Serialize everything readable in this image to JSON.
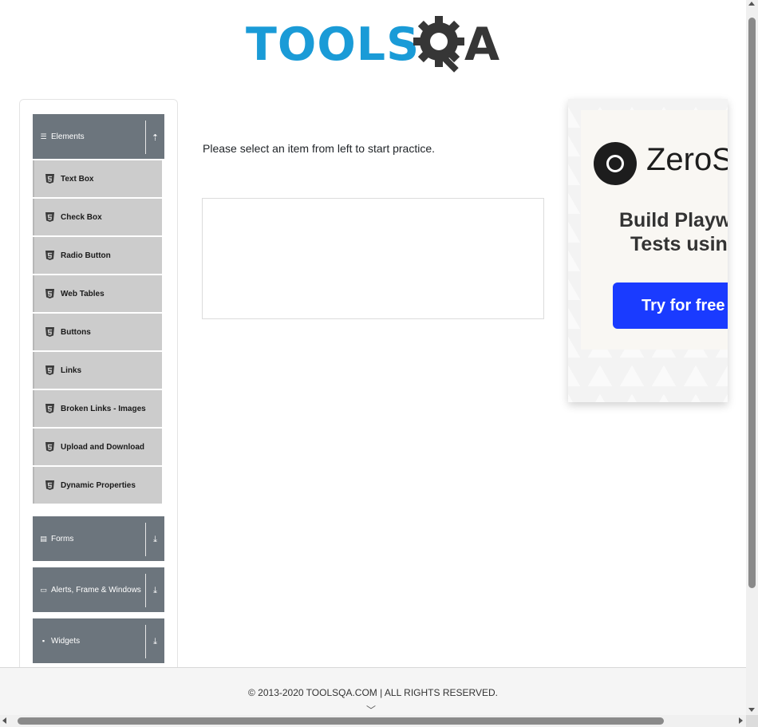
{
  "header": {
    "logo_text": "TOOLSQA",
    "logo_left": "TOOLS",
    "logo_right": "A"
  },
  "sidebar": {
    "groups": [
      {
        "label": "Elements",
        "icon": "hamburger-icon",
        "expanded": true
      },
      {
        "label": "Forms",
        "icon": "document-icon",
        "expanded": false
      },
      {
        "label": "Alerts, Frame & Windows",
        "icon": "window-icon",
        "expanded": false
      },
      {
        "label": "Widgets",
        "icon": "grid-icon",
        "expanded": false
      }
    ],
    "items": [
      {
        "label": "Text Box"
      },
      {
        "label": "Check Box"
      },
      {
        "label": "Radio Button"
      },
      {
        "label": "Web Tables"
      },
      {
        "label": "Buttons"
      },
      {
        "label": "Links"
      },
      {
        "label": "Broken Links - Images"
      },
      {
        "label": "Upload and Download"
      },
      {
        "label": "Dynamic Properties"
      }
    ]
  },
  "main": {
    "instruction": "Please select an item from left to start practice."
  },
  "ad": {
    "brand": "ZeroSt",
    "line1": "Build Playwri",
    "line2": "Tests using",
    "cta": "Try for free -"
  },
  "footer": {
    "text": "© 2013-2020 TOOLSQA.COM | ALL RIGHTS RESERVED."
  },
  "colors": {
    "logo_blue": "#1a9bd7",
    "logo_dark": "#363636",
    "group_header": "#6c757d",
    "menu_item": "#cccccc",
    "ad_button": "#1a3bff"
  }
}
